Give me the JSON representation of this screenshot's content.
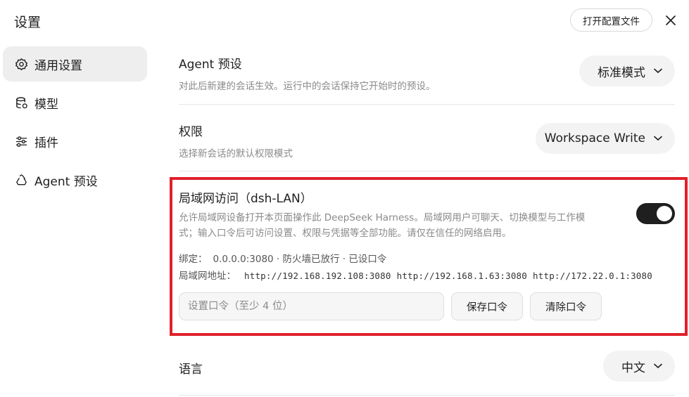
{
  "window": {
    "title": "设置",
    "open_config_label": "打开配置文件"
  },
  "sidebar": {
    "items": [
      {
        "label": "通用设置",
        "icon": "gear-icon",
        "active": true
      },
      {
        "label": "模型",
        "icon": "database-icon",
        "active": false
      },
      {
        "label": "插件",
        "icon": "sliders-icon",
        "active": false
      },
      {
        "label": "Agent 预设",
        "icon": "recycle-icon",
        "active": false
      }
    ]
  },
  "sections": {
    "agent_preset": {
      "title": "Agent 预设",
      "desc": "对此后新建的会话生效。运行中的会话保持它开始时的预设。",
      "value": "标准模式"
    },
    "permission": {
      "title": "权限",
      "desc": "选择新会话的默认权限模式",
      "value": "Workspace Write"
    },
    "lan": {
      "title": "局域网访问（dsh-LAN）",
      "desc": "允许局域网设备打开本页面操作此 DeepSeek Harness。局域网用户可聊天、切换模型与工作模式；输入口令后可访问设置、权限与凭据等全部功能。请仅在信任的网络启用。",
      "enabled": true,
      "bind_label": "绑定：",
      "bind_value": "0.0.0.0:3080 · 防火墙已放行 · 已设口令",
      "addr_label": "局域网地址：",
      "addresses": [
        "http://192.168.192.108:3080",
        "http://192.168.1.63:3080",
        "http://172.22.0.1:3080"
      ],
      "password_placeholder": "设置口令（至少 4 位）",
      "save_label": "保存口令",
      "clear_label": "清除口令"
    },
    "language": {
      "title": "语言",
      "value": "中文"
    }
  },
  "colors": {
    "highlight_border": "#e0202a",
    "toggle_on": "#1f1f1f",
    "active_nav_bg": "#eeeeee"
  }
}
